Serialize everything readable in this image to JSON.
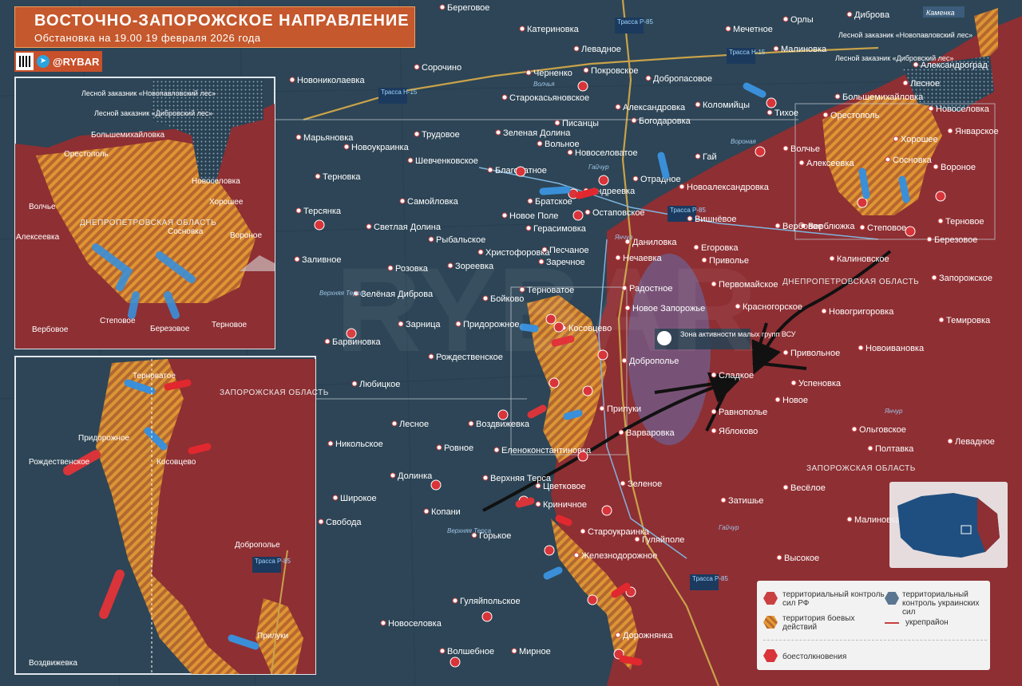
{
  "header": {
    "title": "ВОСТОЧНО-ЗАПОРОЖСКОЕ НАПРАВЛЕНИЕ",
    "subtitle": "Обстановка на 19.00 19 февраля 2026 года"
  },
  "brand": {
    "handle": "@RYBAR",
    "icon": "telegram-icon"
  },
  "colors": {
    "ru_control": "#8e2f33",
    "ua_control": "#2a4152",
    "combat_zone": "#e39a2f",
    "clash": "#d8343a",
    "ua_arrow": "#3a8fd8",
    "ru_arrow": "#e0282e",
    "activity_zone": "#6f5f8e"
  },
  "labels": {
    "oblast_dnipro": "ДНЕПРОПЕТРОВСКАЯ ОБЛАСТЬ",
    "oblast_zap": "ЗАПОРОЖСКАЯ ОБЛАСТЬ",
    "activity_zone": "Зона активности малых групп ВСУ",
    "reserve_novopavlovsky": "Лесной заказник «Новопавловский лес»",
    "reserve_dibrovsky": "Лесной заказник «Дибровский лес»",
    "kamenka": "Каменка",
    "inset1_oblast": "ДНЕПРОПЕТРОВСКАЯ ОБЛАСТЬ",
    "inset2_oblast": "ЗАПОРОЖСКАЯ ОБЛАСТЬ"
  },
  "roads": [
    "Трасса Р-85",
    "Трасса Н-15",
    "Трасса Н-15",
    "Трасса Р-85",
    "Трасса Р-85",
    "Трасса Р-85"
  ],
  "rivers": [
    "Волчья",
    "Гайчур",
    "Янчур",
    "Верхняя Терса",
    "Гайчур",
    "Янчур",
    "Верхняя Терса",
    "Вороная",
    "Волчья",
    "Волчья",
    "Вороная",
    "Гайчур",
    "Янчур"
  ],
  "towns": [
    "Береговое",
    "Катериновка",
    "Левадное",
    "Черненко",
    "Покровское",
    "Добропасовое",
    "Мечетное",
    "Орлы",
    "Дибровa",
    "Малиновка",
    "Сорочино",
    "Новониколаевка",
    "Старокасьяновское",
    "Александровка",
    "Коломийцы",
    "Тихое",
    "Большемихайловка",
    "Лесное",
    "Александроград",
    "Новоселовка",
    "Орестополь",
    "Марьяновка",
    "Новоукраинка",
    "Трудовое",
    "Зеленая Долина",
    "Писанцы",
    "Богодаровка",
    "Вольное",
    "Новоселоватое",
    "Гай",
    "Волчье",
    "Хорошее",
    "Январское",
    "Алексеевка",
    "Сосновка",
    "Вороное",
    "Шевченковское",
    "Благодатное",
    "Андреевка",
    "Отрадное",
    "Новоалександровка",
    "Терновка",
    "Самойловка",
    "Братское",
    "Остаповское",
    "Вишнёвое",
    "Верблюжка",
    "Терсянка",
    "Светлая Долина",
    "Рыбальское",
    "Новое Поле",
    "Герасимовка",
    "Даниловка",
    "Вербовое",
    "Степовое",
    "Березовое",
    "Терновое",
    "Заливное",
    "Розовка",
    "Христофоровка",
    "Песчаное",
    "Егоровка",
    "Калиновское",
    "Запорожское",
    "Зореевка",
    "Заречное",
    "Нечаевка",
    "Приволье",
    "Первомайское",
    "Зелёная Диброва",
    "Бойково",
    "Терноватое",
    "Радостное",
    "Красногорское",
    "Новогригоровка",
    "Темировка",
    "Барвиновка",
    "Зарница",
    "Придорожное",
    "Косовцево",
    "Новое Запорожье",
    "Рождественское",
    "Доброполье",
    "Привольное",
    "Новоивановка",
    "Любицкое",
    "Сладкое",
    "Успеновка",
    "Новое",
    "Лесное",
    "Воздвижевка",
    "Прилуки",
    "Равнополье",
    "Никольское",
    "Варваровка",
    "Левадное",
    "Ольговское",
    "Ровное",
    "Еленоконстантиновка",
    "Яблоково",
    "Полтавка",
    "Долинка",
    "Верхняя Терса",
    "Цветковое",
    "Зеленое",
    "Широкое",
    "Копани",
    "Криничное",
    "Затишье",
    "Весёлое",
    "Свобода",
    "Горькое",
    "Староукраинка",
    "Гуляйполе",
    "Малиновка",
    "Железнодорожное",
    "Высокое",
    "Гуляйпольское",
    "Новоселовка",
    "Дорожнянка",
    "Волшебное",
    "Мирное"
  ],
  "inset1": {
    "towns": [
      "Большемихайловка",
      "Орестополь",
      "Новоселовка",
      "Волчье",
      "Хорошее",
      "Алексеевка",
      "Сосновка",
      "Вороное",
      "Вербовое",
      "Степовое",
      "Березовое",
      "Терновое"
    ],
    "rivers": [
      "Волчья",
      "Вороная",
      "Волчья",
      "Вороная"
    ],
    "road": "Трасса Н-15"
  },
  "inset2": {
    "towns": [
      "Терноватое",
      "Придорожное",
      "Рождественское",
      "Косовцево",
      "Доброполье",
      "Прилуки",
      "Воздвижевка"
    ],
    "rivers": [
      "Янчур"
    ],
    "road": "Трасса Р-85"
  },
  "legend": {
    "ru_control": "территориальный контроль сил РФ",
    "ua_control": "территориальный контроль украинских сил",
    "combat_zone": "территория боевых действий",
    "fortified": "укрепрайон",
    "clash": "боестолкновения"
  }
}
